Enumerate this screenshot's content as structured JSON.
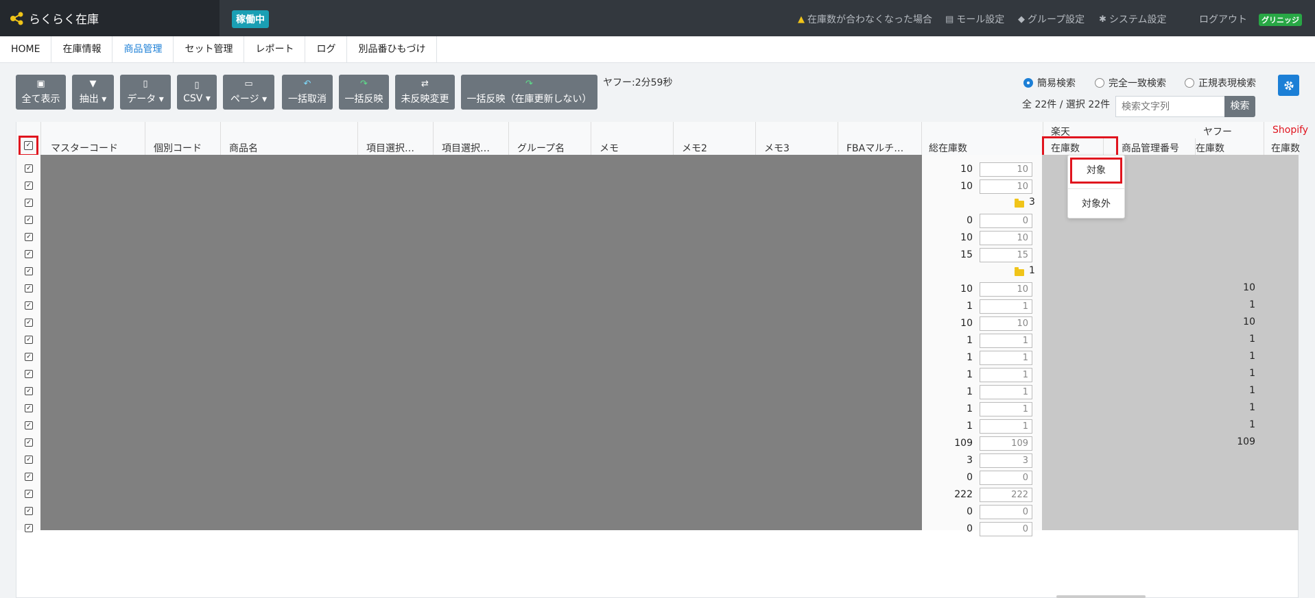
{
  "app": {
    "title": "らくらく在庫",
    "status": "稼働中"
  },
  "topnav": {
    "warning": "在庫数が合わなくなった場合",
    "mall": "モール設定",
    "group": "グループ設定",
    "system": "システム設定",
    "logout": "ログアウト",
    "badge": "グリニッジ"
  },
  "menu": [
    "HOME",
    "在庫情報",
    "商品管理",
    "セット管理",
    "レポート",
    "ログ",
    "別品番ひもづけ"
  ],
  "toolbar": {
    "show_all": "全て表示",
    "extract": "抽出",
    "data": "データ",
    "csv": "CSV",
    "page": "ページ",
    "bulk_cancel": "一括取消",
    "bulk_apply": "一括反映",
    "unapplied_change": "未反映変更",
    "bulk_apply_no_update": "一括反映（在庫更新しない）"
  },
  "timer": "ヤフー:2分59秒",
  "search": {
    "mode_simple": "簡易検索",
    "mode_exact": "完全一致検索",
    "mode_regex": "正規表現検索",
    "count": "全 22件 / 選択 22件",
    "placeholder": "検索文字列",
    "button": "検索"
  },
  "columns": {
    "master_code": "マスターコード",
    "individual_code": "個別コード",
    "product_name": "商品名",
    "option1": "項目選択…",
    "option2": "項目選択…",
    "group_name": "グループ名",
    "memo": "メモ",
    "memo2": "メモ2",
    "memo3": "メモ3",
    "fba": "FBAマルチ…",
    "total_stock": "総在庫数",
    "rakuten": "楽天",
    "rakuten_stock": "在庫数",
    "rakuten_mgmt": "商品管理番号",
    "yahoo": "ヤフー",
    "yahoo_stock": "在庫数",
    "shopify": "Shopify",
    "shopify_stock": "在庫数"
  },
  "rows": [
    {
      "total": "10",
      "input": "10",
      "yahoo": ""
    },
    {
      "total": "10",
      "input": "10",
      "yahoo": ""
    },
    {
      "folder": "3",
      "yahoo": ""
    },
    {
      "total": "0",
      "input": "0",
      "yahoo": ""
    },
    {
      "total": "10",
      "input": "10",
      "yahoo": ""
    },
    {
      "total": "15",
      "input": "15",
      "yahoo": ""
    },
    {
      "folder": "1",
      "yahoo": ""
    },
    {
      "total": "10",
      "input": "10",
      "yahoo": "10"
    },
    {
      "total": "1",
      "input": "1",
      "yahoo": "1"
    },
    {
      "total": "10",
      "input": "10",
      "yahoo": "10"
    },
    {
      "total": "1",
      "input": "1",
      "yahoo": "1"
    },
    {
      "total": "1",
      "input": "1",
      "yahoo": "1"
    },
    {
      "total": "1",
      "input": "1",
      "yahoo": "1"
    },
    {
      "total": "1",
      "input": "1",
      "yahoo": "1"
    },
    {
      "total": "1",
      "input": "1",
      "yahoo": "1"
    },
    {
      "total": "1",
      "input": "1",
      "yahoo": "1"
    },
    {
      "total": "109",
      "input": "109",
      "yahoo": "109"
    },
    {
      "total": "3",
      "input": "3",
      "yahoo": ""
    },
    {
      "total": "0",
      "input": "0",
      "yahoo": ""
    },
    {
      "total": "222",
      "input": "222",
      "yahoo": ""
    },
    {
      "total": "0",
      "input": "0",
      "yahoo": ""
    },
    {
      "total": "0",
      "input": "0",
      "yahoo": ""
    }
  ],
  "dropdown": {
    "target": "対象",
    "exclude": "対象外"
  },
  "colors": {
    "accent": "#1c7fd6",
    "highlight": "#e0141e",
    "status": "#1a9fb4",
    "shopify": "#e0141e"
  }
}
